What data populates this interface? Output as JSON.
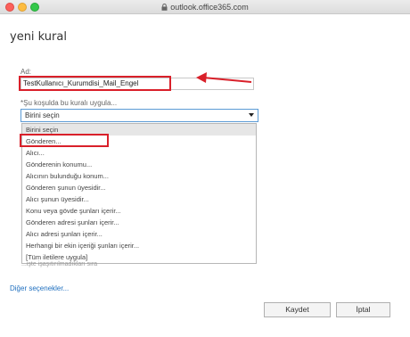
{
  "browser": {
    "url": "outlook.office365.com"
  },
  "page": {
    "title": "yeni kural"
  },
  "form": {
    "name_label": "Ad:",
    "name_value": "TestKullanıcı_Kurumdisi_Mail_Engel",
    "condition_label": "*Şu koşulda bu kuralı uygula...",
    "condition_selected": "Birini seçin",
    "options": [
      "Birini seçin",
      "Gönderen...",
      "Alıcı...",
      "Gönderenin konumu...",
      "Alıcının bulunduğu konum...",
      "Gönderen şunun üyesidir...",
      "Alıcı şunun üyesidir...",
      "Konu veya gövde şunları içerir...",
      "Gönderen adresi şunları içerir...",
      "Alıcı adresi şunları içerir...",
      "Herhangi bir ekin içeriği şunları içerir...",
      "[Tüm iletilere uygula]"
    ],
    "hidden_row_text": "...işte işaşıtırılmadıkları sıra"
  },
  "more_options_link": "Diğer seçenekler...",
  "buttons": {
    "save": "Kaydet",
    "cancel": "İptal"
  },
  "colors": {
    "highlight_box": "#d9202a",
    "link": "#1f6fbf",
    "focus_border": "#5b9bd5"
  }
}
